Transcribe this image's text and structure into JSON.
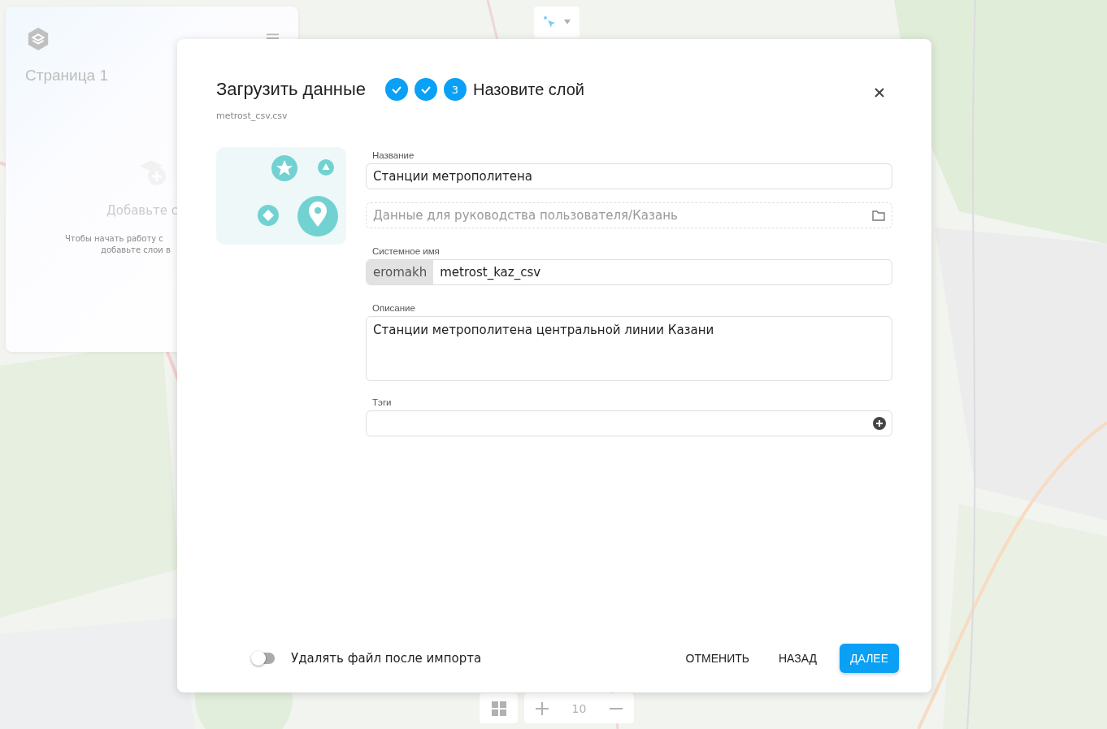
{
  "background": {
    "page_panel": {
      "title": "Страница 1",
      "empty_title": "Добавьте с",
      "empty_lines": [
        "Чтобы начать работу с",
        "добавьте слои в"
      ]
    },
    "zoom": {
      "value": "10"
    }
  },
  "dialog": {
    "title": "Загрузить данные",
    "file_name": "metrost_csv.csv",
    "steps": [
      {
        "done": true
      },
      {
        "done": true
      },
      {
        "done": false,
        "number": "3"
      }
    ],
    "step_title": "Назовите слой",
    "fields": {
      "name": {
        "label": "Название",
        "value": "Станции метрополитена"
      },
      "folder": {
        "value": "Данные для руководства пользователя/Казань"
      },
      "system_name": {
        "label": "Системное имя",
        "prefix": "eromakh",
        "value": "metrost_kaz_csv"
      },
      "description": {
        "label": "Описание",
        "value": "Станции метрополитена центральной линии Казани"
      },
      "tags": {
        "label": "Тэги"
      }
    },
    "delete_after_import": {
      "label": "Удалять файл после импорта",
      "on": false
    },
    "buttons": {
      "cancel": "ОТМЕНИТЬ",
      "back": "НАЗАД",
      "next": "ДАЛЕЕ"
    }
  }
}
